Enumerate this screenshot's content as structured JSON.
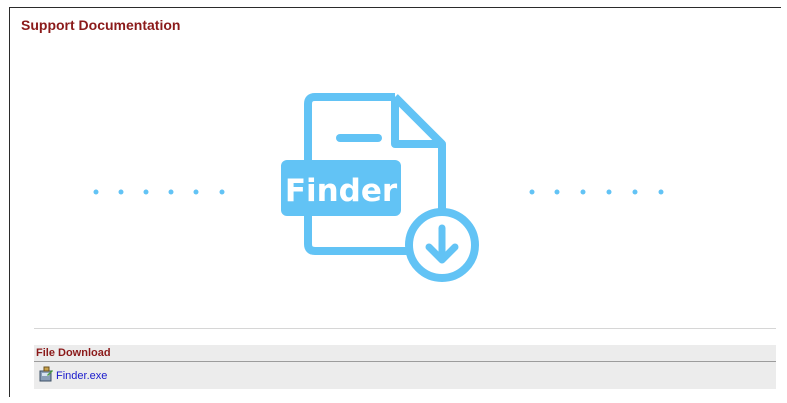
{
  "page": {
    "title": "Support Documentation"
  },
  "hero": {
    "icon_label": "Finder",
    "icon_name": "file-download-icon",
    "accent_color": "#62c3f5"
  },
  "file_download": {
    "header": "File Download",
    "files": [
      {
        "name": "Finder.exe",
        "icon": "installer-icon"
      }
    ]
  }
}
